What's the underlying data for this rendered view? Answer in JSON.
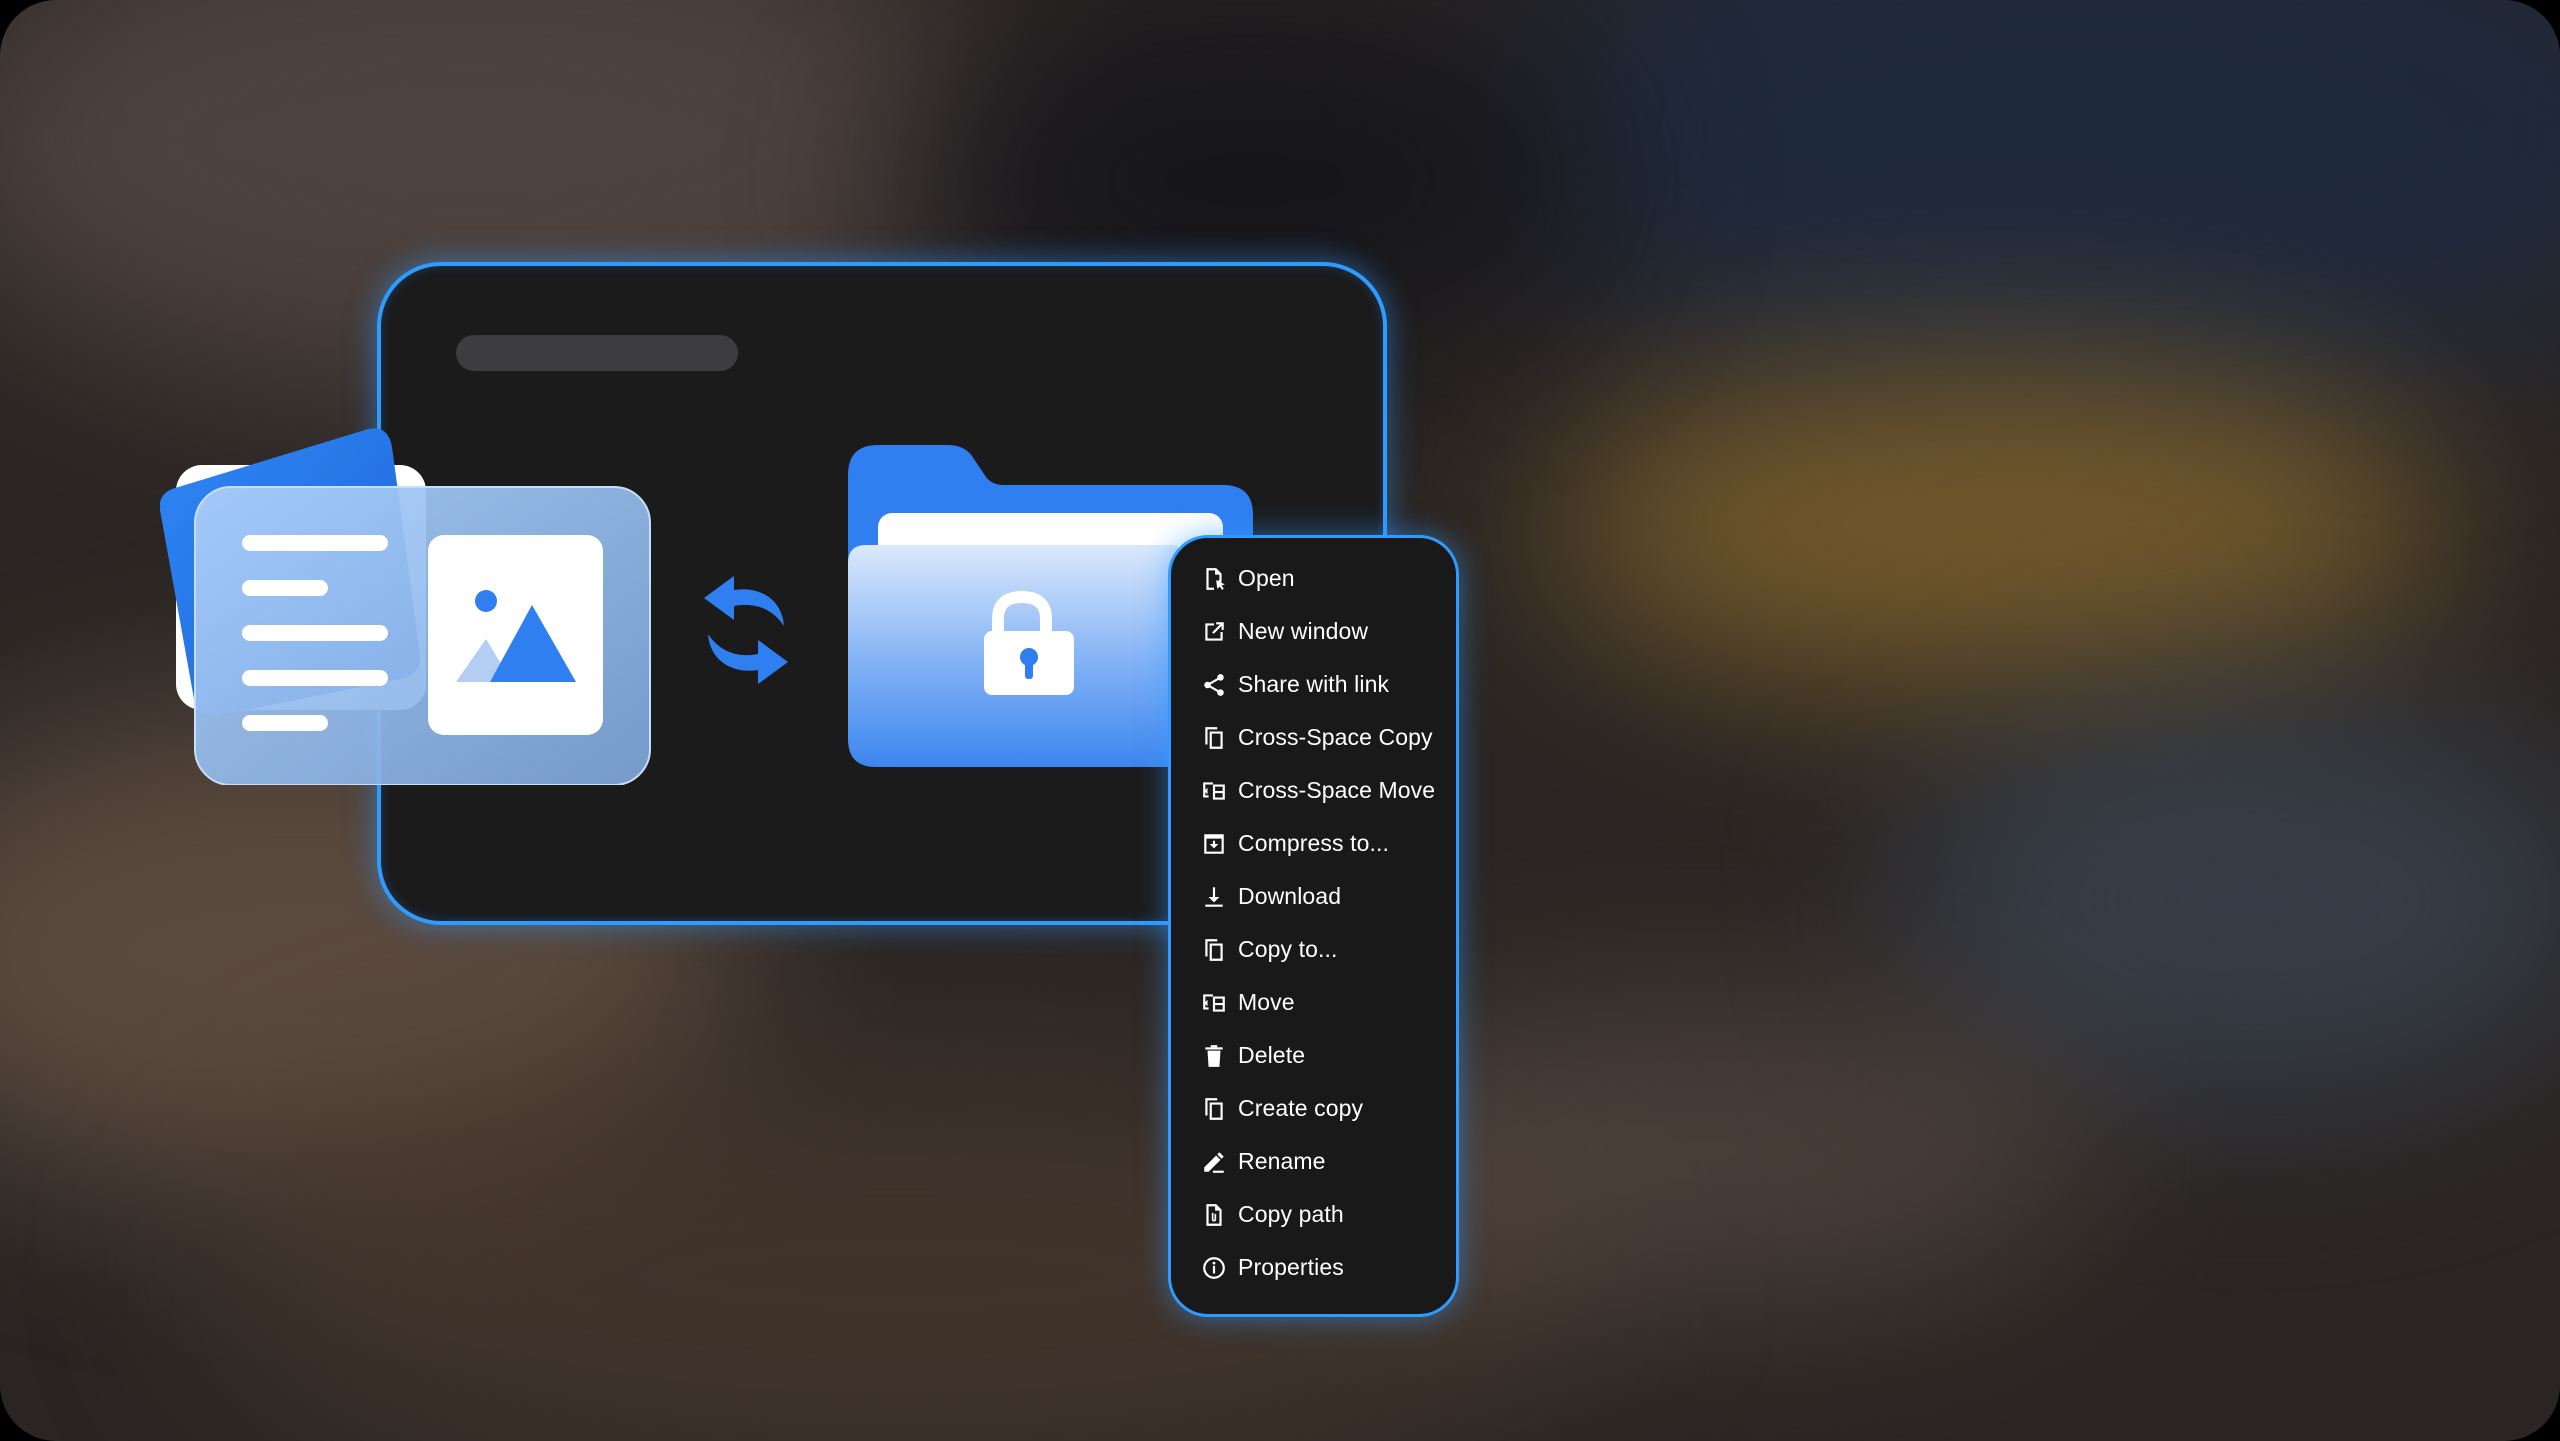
{
  "context_menu": {
    "items": [
      {
        "label": "Open",
        "icon": "open-file-icon"
      },
      {
        "label": "New window",
        "icon": "external-link-icon"
      },
      {
        "label": "Share with link",
        "icon": "share-icon"
      },
      {
        "label": "Cross-Space Copy",
        "icon": "copy-icon"
      },
      {
        "label": "Cross-Space Move",
        "icon": "move-icon"
      },
      {
        "label": "Compress to...",
        "icon": "compress-icon"
      },
      {
        "label": "Download",
        "icon": "download-icon"
      },
      {
        "label": "Copy to...",
        "icon": "copy-icon"
      },
      {
        "label": "Move",
        "icon": "move-icon"
      },
      {
        "label": "Delete",
        "icon": "trash-icon"
      },
      {
        "label": "Create copy",
        "icon": "copy-icon"
      },
      {
        "label": "Rename",
        "icon": "pencil-icon"
      },
      {
        "label": "Copy path",
        "icon": "clip-file-icon"
      },
      {
        "label": "Properties",
        "icon": "info-icon"
      }
    ]
  },
  "colors": {
    "accent": "#2f9bff",
    "menu_bg": "#19191a",
    "window_bg": "#1b1b1c",
    "blue_primary": "#2f7ff0"
  }
}
